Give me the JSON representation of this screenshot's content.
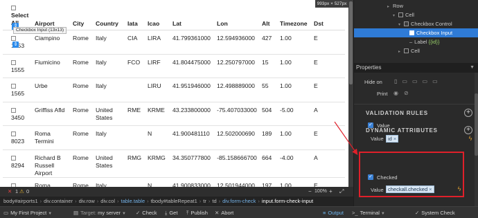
{
  "canvas": {
    "size_badge": "993px × 527px",
    "control_tag": "Checkbox Input (13x13)",
    "table": {
      "select_label": "Select",
      "all_label": "All",
      "columns": [
        "Airport",
        "City",
        "Country",
        "Iata",
        "Icao",
        "Lat",
        "Lon",
        "Alt",
        "Timezone",
        "Dst"
      ],
      "rows": [
        {
          "id": "1553",
          "airport": "Ciampino",
          "city": "Rome",
          "country": "Italy",
          "iata": "CIA",
          "icao": "LIRA",
          "lat": "41.799361000",
          "lon": "12.594936000",
          "alt": "427",
          "timezone": "1.00",
          "dst": "E"
        },
        {
          "id": "1555",
          "airport": "Fiumicino",
          "city": "Rome",
          "country": "Italy",
          "iata": "FCO",
          "icao": "LIRF",
          "lat": "41.804475000",
          "lon": "12.250797000",
          "alt": "15",
          "timezone": "1.00",
          "dst": "E"
        },
        {
          "id": "1565",
          "airport": "Urbe",
          "city": "Rome",
          "country": "Italy",
          "iata": "",
          "icao": "LIRU",
          "lat": "41.951946000",
          "lon": "12.498889000",
          "alt": "55",
          "timezone": "1.00",
          "dst": "E"
        },
        {
          "id": "3450",
          "airport": "Griffiss Afld",
          "city": "Rome",
          "country": "United States",
          "iata": "RME",
          "icao": "KRME",
          "lat": "43.233800000",
          "lon": "-75.407033000",
          "alt": "504",
          "timezone": "-5.00",
          "dst": "A"
        },
        {
          "id": "8023",
          "airport": "Roma Termini",
          "city": "Rome",
          "country": "Italy",
          "iata": "",
          "icao": "N",
          "lat": "41.900481110",
          "lon": "12.502000690",
          "alt": "189",
          "timezone": "1.00",
          "dst": "E"
        },
        {
          "id": "8294",
          "airport": "Richard B Russell Airport",
          "city": "Rome",
          "country": "United States",
          "iata": "RMG",
          "icao": "KRMG",
          "lat": "34.350777800",
          "lon": "-85.158666700",
          "alt": "664",
          "timezone": "-4.00",
          "dst": "A"
        },
        {
          "id": "8910",
          "airport": "Roma Termini",
          "city": "Rome",
          "country": "Italy",
          "iata": "",
          "icao": "N",
          "lat": "41.900833000",
          "lon": "12.501944000",
          "alt": "197",
          "timezone": "1.00",
          "dst": "E"
        }
      ]
    }
  },
  "status": {
    "errors": "1",
    "warnings": "0",
    "zoom": "100%"
  },
  "breadcrumbs": {
    "items": [
      "body#airports1",
      "div.container",
      "div.row",
      "div.col",
      "table.table",
      "tbody#tableRepeat1",
      "tr",
      "td",
      "div.form-check",
      "input.form-check-input"
    ]
  },
  "toolbar": {
    "project": "My First Project",
    "target_label": "Target:",
    "target_value": "my server",
    "check": "Check",
    "get": "Get",
    "publish": "Publish",
    "abort": "Abort",
    "output": "Output",
    "terminal": "Terminal",
    "system_check": "System Check"
  },
  "dom_panel": {
    "rows": [
      {
        "label": "Row"
      },
      {
        "label": "Cell"
      },
      {
        "label": "Checkbox Control"
      },
      {
        "label": "Checkbox Input"
      },
      {
        "label": "Label",
        "bind": "{{id}}"
      },
      {
        "label": "Cell"
      }
    ]
  },
  "properties": {
    "header": "Properties",
    "hide_on_label": "Hide on",
    "print_label": "Print",
    "validation_title": "VALIDATION RULES",
    "dynamic_title": "DYNAMIC ATTRIBUTES",
    "value_attr": {
      "name": "Value",
      "value_label": "Value",
      "value": "id"
    },
    "checked_attr": {
      "name": "Checked",
      "value_label": "Value",
      "value": "checkall.checked"
    }
  },
  "colors": {
    "accent": "#2f7bd6",
    "highlight_box": "#e0202a",
    "bind_tag": "#d8e6f3"
  }
}
